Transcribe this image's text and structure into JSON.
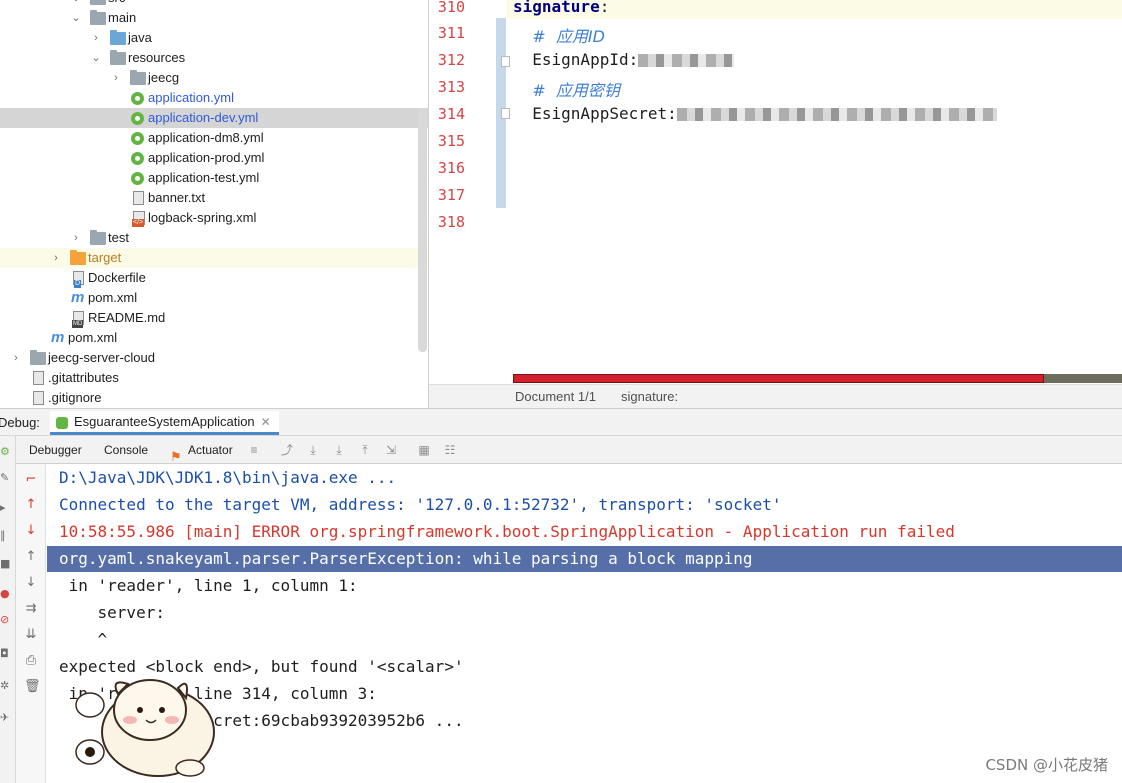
{
  "project_tree": {
    "items": [
      {
        "label": "src",
        "kind": "folder",
        "color": "gray",
        "expanded": true
      },
      {
        "label": "main",
        "kind": "folder",
        "color": "gray",
        "expanded": true
      },
      {
        "label": "java",
        "kind": "folder",
        "color": "blue",
        "expanded": false
      },
      {
        "label": "resources",
        "kind": "folder",
        "color": "gray",
        "expanded": true
      },
      {
        "label": "jeecg",
        "kind": "folder",
        "color": "gray",
        "expanded": false
      },
      {
        "label": "application.yml",
        "kind": "yml",
        "color": "blue"
      },
      {
        "label": "application-dev.yml",
        "kind": "yml",
        "color": "blue",
        "selected": true
      },
      {
        "label": "application-dm8.yml",
        "kind": "yml"
      },
      {
        "label": "application-prod.yml",
        "kind": "yml"
      },
      {
        "label": "application-test.yml",
        "kind": "yml"
      },
      {
        "label": "banner.txt",
        "kind": "txt"
      },
      {
        "label": "logback-spring.xml",
        "kind": "xml"
      },
      {
        "label": "test",
        "kind": "folder",
        "color": "gray",
        "expanded": false
      },
      {
        "label": "target",
        "kind": "folder",
        "color": "orange",
        "expanded": false,
        "excluded": true
      },
      {
        "label": "Dockerfile",
        "kind": "docker"
      },
      {
        "label": "pom.xml",
        "kind": "maven"
      },
      {
        "label": "README.md",
        "kind": "md"
      },
      {
        "label": "pom.xml",
        "kind": "maven"
      },
      {
        "label": "jeecg-server-cloud",
        "kind": "folder",
        "color": "gray",
        "expanded": false
      },
      {
        "label": ".gitattributes",
        "kind": "txt"
      },
      {
        "label": ".gitignore",
        "kind": "txt"
      }
    ]
  },
  "editor": {
    "line_numbers": [
      "310",
      "311",
      "312",
      "313",
      "314",
      "315",
      "316",
      "317",
      "318"
    ],
    "lines": {
      "l310_key": "signature",
      "l310_colon": ":",
      "l311_comment": "#  应用ID",
      "l312_key": "EsignAppId:",
      "l313_comment": "#  应用密钥",
      "l314_key": "EsignAppSecret:"
    },
    "redacted_values": true,
    "inspection_progress": 0.87,
    "breadcrumb": {
      "document": "Document 1/1",
      "path": "signature:"
    }
  },
  "debug": {
    "label": "Debug:",
    "run_config_tab": "EsguaranteeSystemApplication",
    "tabs": [
      "Debugger",
      "Console",
      "Actuator"
    ],
    "console_lines": [
      {
        "text": "D:\\Java\\JDK\\JDK1.8\\bin\\java.exe ...",
        "style": "blue"
      },
      {
        "text": "Connected to the target VM, address: '127.0.0.1:52732', transport: 'socket'",
        "style": "blue"
      },
      {
        "text": "10:58:55.986 [main] ERROR org.springframework.boot.SpringApplication - Application run failed",
        "style": "red"
      },
      {
        "text": "org.yaml.snakeyaml.parser.ParserException: while parsing a block mapping",
        "style": "selected"
      },
      {
        "text": " in 'reader', line 1, column 1:",
        "style": "normal"
      },
      {
        "text": "    server:",
        "style": "normal"
      },
      {
        "text": "    ^",
        "style": "normal"
      },
      {
        "text": "expected <block end>, but found '<scalar>'",
        "style": "normal"
      },
      {
        "text": " in 'reader', line 314, column 3:",
        "style": "normal"
      },
      {
        "text": "      EsignAppSecret:69cbab939203952b6 ...",
        "style": "normal"
      }
    ]
  },
  "watermark": "CSDN @小花皮猪",
  "colors": {
    "line_number": "#d64444",
    "yaml_key": "#000080",
    "comment": "#3d7fd6",
    "console_error": "#d6382c",
    "console_info": "#1b4fa8",
    "selection": "#566fa8",
    "progress_red": "#d2202c"
  }
}
